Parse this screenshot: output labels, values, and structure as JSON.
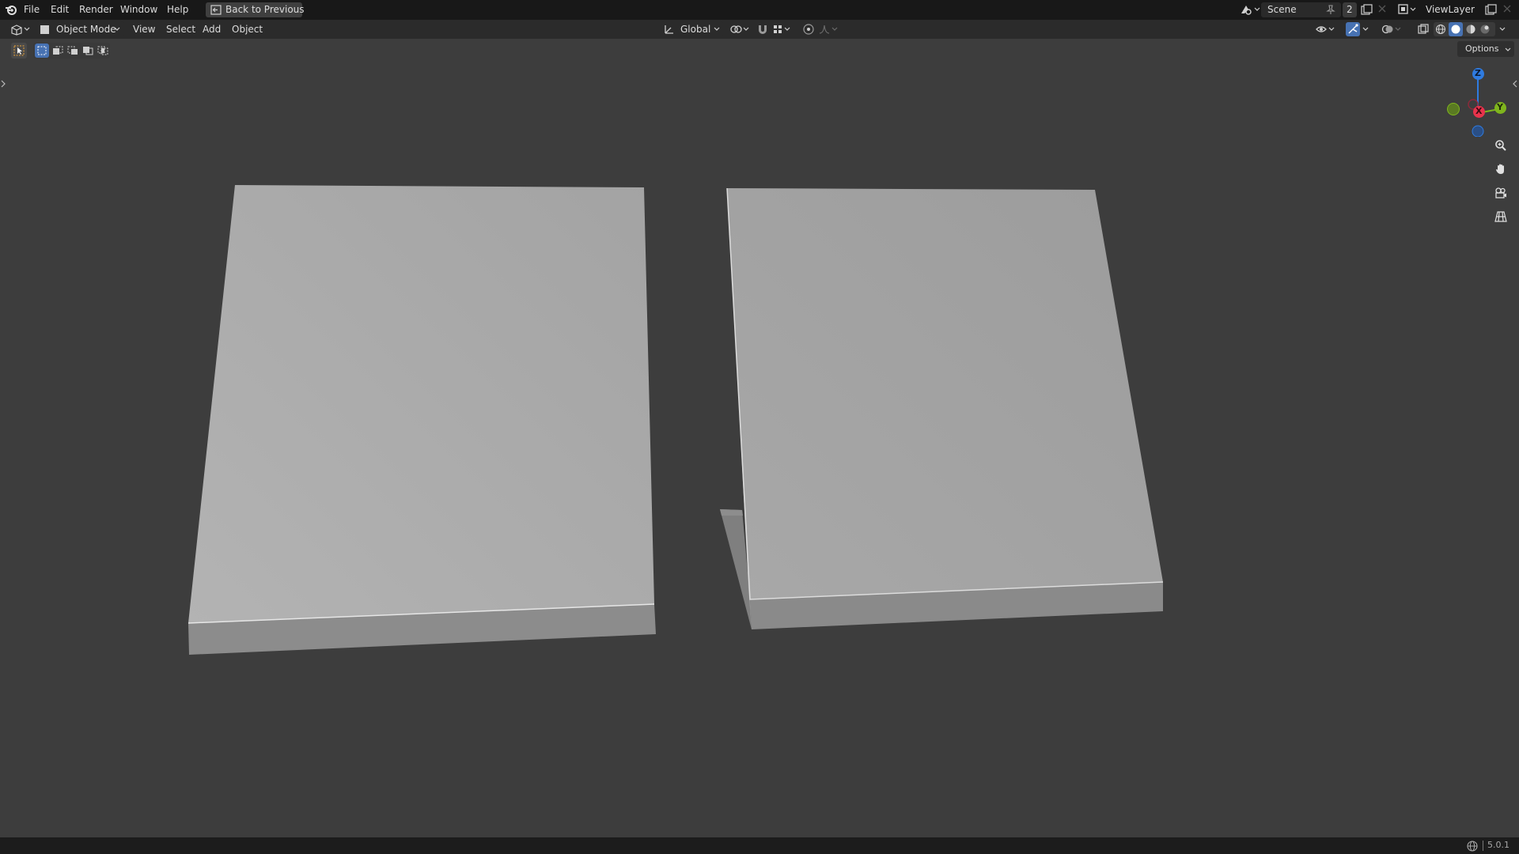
{
  "topbar": {
    "menus": [
      "File",
      "Edit",
      "Render",
      "Window",
      "Help"
    ],
    "back_button": "Back to Previous",
    "scene_name": "Scene",
    "scene_users": "2",
    "viewlayer_name": "ViewLayer"
  },
  "header": {
    "mode": "Object Mode",
    "menus": [
      "View",
      "Select",
      "Add",
      "Object"
    ],
    "transform_orientation": "Global"
  },
  "viewport": {
    "options_label": "Options",
    "gizmo": {
      "z": "Z",
      "x": "X",
      "y": "Y"
    }
  },
  "statusbar": {
    "version": "5.0.1"
  },
  "colors": {
    "topbar_bg": "#181818",
    "header_bg": "#2b2b2b",
    "viewport_bg": "#3d3d3d",
    "axis_x": "#e8334c",
    "axis_y": "#7fb51d",
    "axis_z": "#2f7be0",
    "accent": "#4772b3"
  },
  "icons": [
    "blender-logo",
    "back-icon",
    "scene-icon",
    "pin-icon",
    "new-icon",
    "close-icon",
    "viewlayer-icon",
    "editor-type-icon",
    "object-mode-icon",
    "orientation-icon",
    "pivot-icon",
    "snap-icon",
    "proportional-icon",
    "visibility-icon",
    "gizmo-icon",
    "overlay-icon",
    "xray-icon",
    "shading-icon",
    "select-tool-icon",
    "zoom-icon",
    "pan-icon",
    "camera-icon",
    "grid-icon",
    "language-icon"
  ]
}
